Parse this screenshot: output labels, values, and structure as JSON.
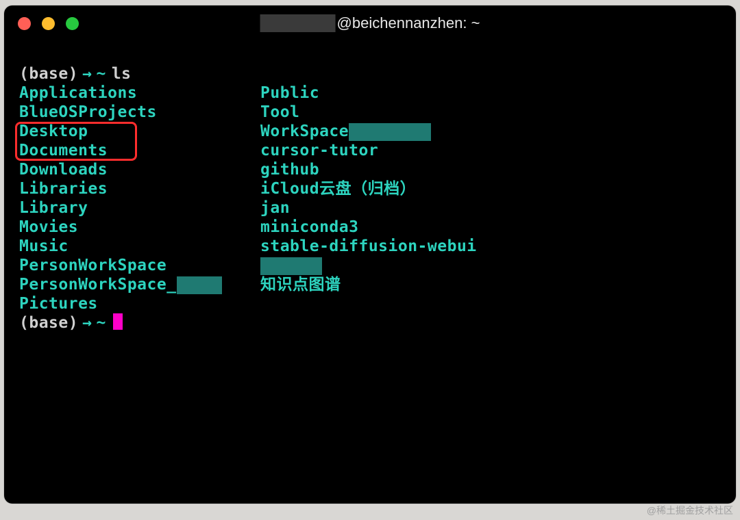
{
  "titlebar": {
    "title_suffix": "@beichennanzhen: ~"
  },
  "prompt1": {
    "env": "(base)",
    "arrow": "→",
    "path": "~",
    "cmd": "ls"
  },
  "ls": {
    "col1": [
      "Applications",
      "BlueOSProjects",
      "Desktop",
      "Documents",
      "Downloads",
      "Libraries",
      "Library",
      "Movies",
      "Music",
      "PersonWorkSpace",
      "PersonWorkSpace_",
      "Pictures"
    ],
    "col2": [
      "Public",
      "Tool",
      "WorkSpace",
      "cursor-tutor",
      "github",
      "iCloud云盘（归档）",
      "jan",
      "miniconda3",
      "stable-diffusion-webui",
      "",
      "知识点图谱"
    ]
  },
  "prompt2": {
    "env": "(base)",
    "arrow": "→",
    "path": "~"
  },
  "watermark": "@稀土掘金技术社区"
}
